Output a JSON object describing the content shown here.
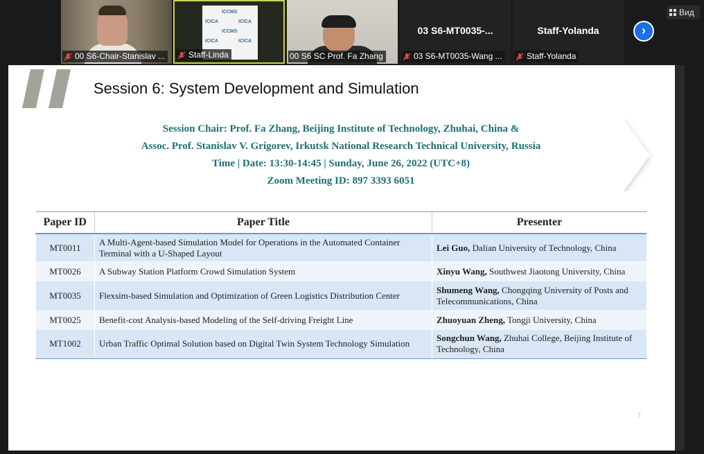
{
  "toolbar": {
    "view_label": "Вид"
  },
  "participants": [
    {
      "name": "00 S6-Chair-Stanislav ..."
    },
    {
      "name": "Staff-Linda",
      "banner_text_1": "ICCMS",
      "banner_text_2": "ICICA"
    },
    {
      "name": "00 S6 SC Prof.  Fa Zhang"
    },
    {
      "name": "03 S6-MT0035-Wang ...",
      "big_name": "03 S6-MT0035-..."
    },
    {
      "name": "Staff-Yolanda",
      "big_name": "Staff-Yolanda"
    }
  ],
  "slide": {
    "title": "Session 6: System Development and Simulation",
    "info_lines": [
      "Session Chair: Prof. Fa Zhang, Beijing Institute of Technology, Zhuhai, China &",
      "Assoc. Prof. Stanislav V. Grigorev, Irkutsk National Research Technical University, Russia",
      "Time | Date: 13:30-14:45 | Sunday, June 26, 2022 (UTC+8)",
      "Zoom Meeting ID: 897 3393 6051"
    ],
    "table": {
      "headers": [
        "Paper ID",
        "Paper Title",
        "Presenter"
      ],
      "rows": [
        {
          "id": "MT0011",
          "title": "A Multi-Agent-based Simulation Model for Operations in the Automated Container Terminal with a U-Shaped Layout",
          "presenter": "Lei Guo,",
          "affiliation": " Dalian University of Technology, China"
        },
        {
          "id": "MT0026",
          "title": "A Subway Station Platform Crowd Simulation System",
          "presenter": "Xinyu Wang,",
          "affiliation": " Southwest Jiaotong University, China"
        },
        {
          "id": "MT0035",
          "title": "Flexsim-based Simulation and Optimization of Green Logistics Distribution Center",
          "presenter": "Shumeng Wang,",
          "affiliation": " Chongqing University of Posts and Telecommunications, China"
        },
        {
          "id": "MT0025",
          "title": "Benefit-cost Analysis-based Modeling of the Self-driving Freight Line",
          "presenter": "Zhuoyuan Zheng,",
          "affiliation": " Tongji University, China"
        },
        {
          "id": "MT1002",
          "title": "Urban Traffic Optimal Solution based on Digital Twin System Technology Simulation",
          "presenter": "Songchun Wang,",
          "affiliation": " Zhuhai College, Beijing Institute of Technology, China"
        }
      ]
    },
    "page_number": "7"
  },
  "colors": {
    "accent_teal": "#1f6e73",
    "table_blue": "#d9e6f5",
    "zoom_blue": "#1c6fe0",
    "active_border": "#c9d34a"
  }
}
